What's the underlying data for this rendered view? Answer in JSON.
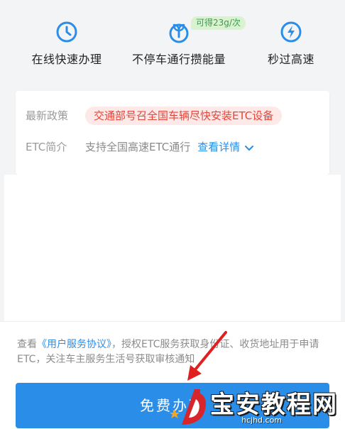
{
  "features": [
    {
      "label": "在线快速办理",
      "icon": "clock-icon"
    },
    {
      "label": "不停车通行攒能量",
      "icon": "sprout-icon"
    },
    {
      "label": "秒过高速",
      "icon": "lightning-icon"
    }
  ],
  "feature_badge": "可得23g/次",
  "policy": {
    "latest_label": "最新政策",
    "latest_text": "交通部号召全国车辆尽快安装ETC设备",
    "intro_label": "ETC简介",
    "intro_text": "支持全国高速ETC通行",
    "details_link": "查看详情"
  },
  "agreement": {
    "prefix": "查看",
    "link": "《用户服务协议》",
    "suffix": "，授权ETC服务获取身份证、收货地址用于申请ETC，关注车主服务生活号获取审核通知"
  },
  "cta_label": "免费办理",
  "watermark": {
    "brand": "宝安教程网",
    "domain": "hcjhd.com"
  },
  "colors": {
    "accent": "#2a8ee8",
    "policy_red": "#e5453a",
    "badge_green": "#3a9b4f",
    "arrow_red": "#e02020"
  }
}
